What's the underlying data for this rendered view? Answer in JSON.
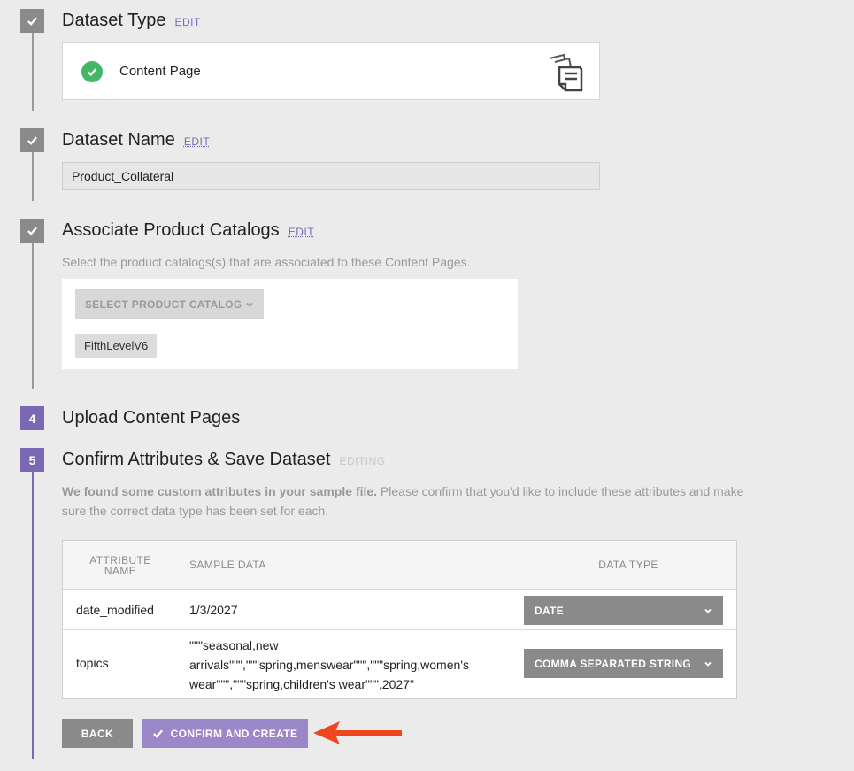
{
  "steps": {
    "s1": {
      "title": "Dataset Type",
      "edit": "EDIT"
    },
    "s2": {
      "title": "Dataset Name",
      "edit": "EDIT"
    },
    "s3": {
      "title": "Associate Product Catalogs",
      "edit": "EDIT",
      "description": "Select the product catalogs(s) that are associated to these Content Pages."
    },
    "s4": {
      "number": "4",
      "title": "Upload Content Pages"
    },
    "s5": {
      "number": "5",
      "title": "Confirm Attributes & Save Dataset",
      "status": "EDITING",
      "description_bold": "We found some custom attributes in your sample file.",
      "description_rest": " Please confirm that you'd like to include these attributes and make sure the correct data type has been set for each."
    }
  },
  "dataset_type": {
    "label": "Content Page",
    "icon": "content-page-document-icon"
  },
  "dataset_name": {
    "value": "Product_Collateral"
  },
  "catalogs": {
    "select_label": "SELECT PRODUCT CATALOG",
    "selected": [
      "FifthLevelV6"
    ]
  },
  "table": {
    "headers": {
      "attr_name_line1": "ATTRIBUTE",
      "attr_name_line2": "NAME",
      "sample": "SAMPLE DATA",
      "dtype": "DATA TYPE"
    },
    "rows": [
      {
        "name": "date_modified",
        "sample": "1/3/2027",
        "dtype": "DATE"
      },
      {
        "name": "topics",
        "sample_lines": [
          "\"\"\"seasonal,new",
          "arrivals\"\"\",\"\"\"spring,menswear\"\"\",\"\"\"spring,women's",
          "wear\"\"\",\"\"\"spring,children's wear\"\"\",2027\""
        ],
        "dtype": "COMMA SEPARATED STRING"
      }
    ]
  },
  "actions": {
    "back": "BACK",
    "confirm": "CONFIRM AND CREATE"
  },
  "colors": {
    "accent": "#7b68b5",
    "success": "#43b768",
    "annotation_arrow": "#f0461e"
  }
}
